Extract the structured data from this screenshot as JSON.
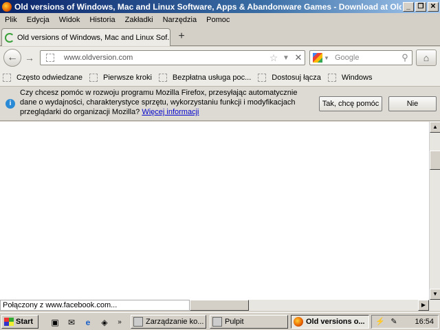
{
  "window": {
    "title": "Old versions of Windows, Mac and Linux Software, Apps & Abandonware Games - Download at OldV...",
    "minimize_icon": "minimize-icon",
    "maximize_icon": "restore-icon",
    "close_icon": "close-icon"
  },
  "menu": [
    "Plik",
    "Edycja",
    "Widok",
    "Historia",
    "Zakładki",
    "Narzędzia",
    "Pomoc"
  ],
  "tab": {
    "label": "Old versions of Windows, Mac and Linux Sof...",
    "new_tab": "+"
  },
  "nav": {
    "back": "←",
    "forward": "→",
    "url": "www.oldversion.com",
    "search_placeholder": "Google",
    "home": "⌂"
  },
  "bookmarks": [
    "Często odwiedzane",
    "Pierwsze kroki",
    "Bezpłatna usługa poc...",
    "Dostosuj łącza",
    "Windows"
  ],
  "notification": {
    "message": "Czy chcesz pomóc w rozwoju programu Mozilla Firefox, przesyłając automatycznie dane o wydajności, charakterystyce sprzętu, wykorzystaniu funkcji i modyfikacjach przeglądarki do organizacji Mozilla?",
    "more_link": "Więcej informacji",
    "yes_button": "Tak, chcę pomóc",
    "no_button": "Nie"
  },
  "status": {
    "text": "Połączony z www.facebook.com..."
  },
  "taskbar": {
    "start": "Start",
    "tasks": [
      "Zarządzanie ko...",
      "Pulpit",
      "Old versions o..."
    ],
    "clock": "16:54"
  }
}
